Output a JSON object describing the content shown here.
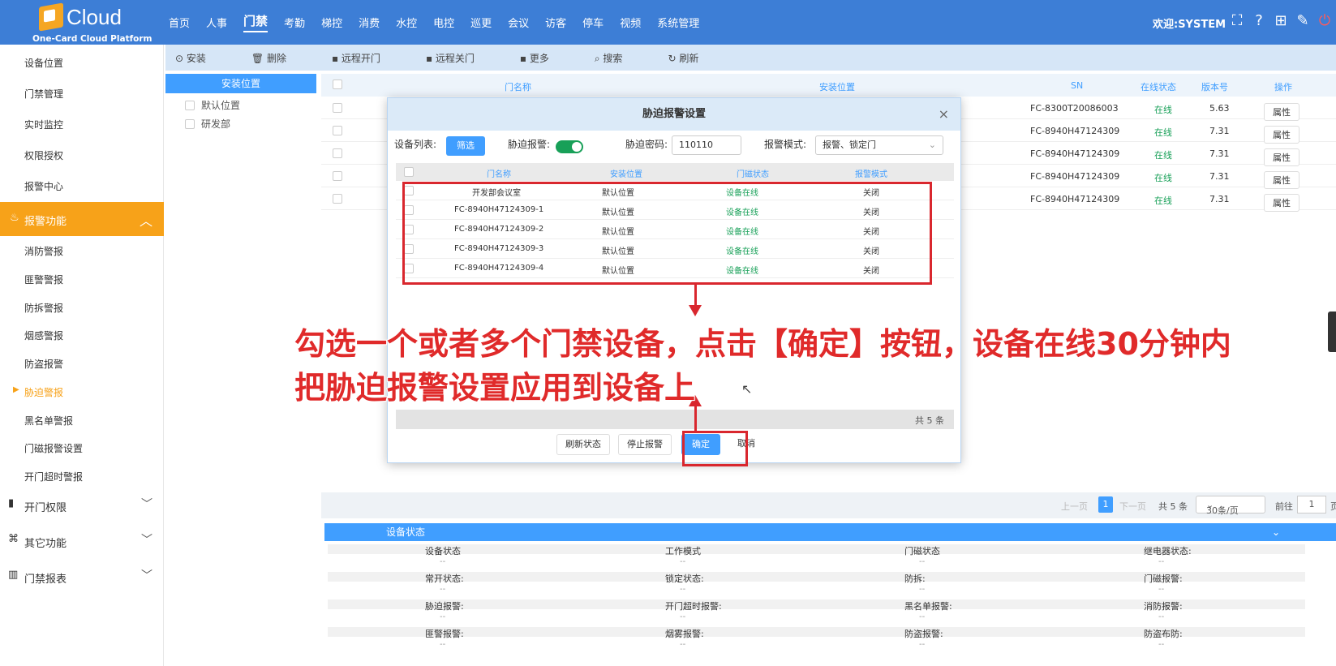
{
  "header": {
    "brand": "Cloud",
    "subtitle": "One-Card Cloud Platform",
    "nav": [
      "首页",
      "人事",
      "门禁",
      "考勤",
      "梯控",
      "消费",
      "水控",
      "电控",
      "巡更",
      "会议",
      "访客",
      "停车",
      "视频",
      "系统管理"
    ],
    "welcome": "欢迎:SYSTEM"
  },
  "sidebar": {
    "top_items": [
      "设备位置",
      "门禁管理",
      "实时监控",
      "权限授权",
      "报警中心"
    ],
    "group": "报警功能",
    "group_items": [
      "消防警报",
      "匪警警报",
      "防拆警报",
      "烟感警报",
      "防盗报警",
      "胁迫警报",
      "黑名单警报",
      "门磁报警设置",
      "开门超时警报"
    ],
    "collapsed": [
      "开门权限",
      "其它功能",
      "门禁报表"
    ]
  },
  "toolbar": [
    "安装",
    "删除",
    "远程开门",
    "远程关门",
    "更多",
    "搜索",
    "刷新"
  ],
  "tree": {
    "header": "安装位置",
    "nodes": [
      "默认位置",
      "研发部"
    ]
  },
  "main_table": {
    "headers": [
      "门名称",
      "安装位置",
      "SN",
      "在线状态",
      "版本号",
      "操作"
    ],
    "rows": [
      {
        "sn": "FC-8300T20086003",
        "status": "在线",
        "version": "5.63",
        "op": "属性"
      },
      {
        "sn": "FC-8940H47124309",
        "status": "在线",
        "version": "7.31",
        "op": "属性"
      },
      {
        "sn": "FC-8940H47124309",
        "status": "在线",
        "version": "7.31",
        "op": "属性"
      },
      {
        "sn": "FC-8940H47124309",
        "status": "在线",
        "version": "7.31",
        "op": "属性"
      },
      {
        "sn": "FC-8940H47124309",
        "status": "在线",
        "version": "7.31",
        "op": "属性"
      }
    ]
  },
  "pager": {
    "prev": "上一页",
    "page": "1",
    "next": "下一页",
    "total": "共 5 条",
    "size": "30条/页",
    "goto": "前往",
    "goto_value": "1",
    "page_suffix": "页"
  },
  "device_status": {
    "title": "设备状态",
    "rows": [
      [
        "设备状态",
        "工作模式",
        "门磁状态",
        "继电器状态:"
      ],
      [
        "常开状态:",
        "锁定状态:",
        "防拆:",
        "门磁报警:"
      ],
      [
        "胁迫报警:",
        "开门超时报警:",
        "黑名单报警:",
        "消防报警:"
      ],
      [
        "匪警报警:",
        "烟雾报警:",
        "防盗报警:",
        "防盗布防:"
      ]
    ],
    "placeholder": "--"
  },
  "modal": {
    "title": "胁迫报警设置",
    "device_list_label": "设备列表:",
    "filter_btn": "筛选",
    "duress_alarm_label": "胁迫报警:",
    "duress_pwd_label": "胁迫密码:",
    "duress_pwd_value": "110110",
    "alarm_mode_label": "报警模式:",
    "alarm_mode_value": "报警、锁定门",
    "headers": [
      "门名称",
      "安装位置",
      "门磁状态",
      "报警模式"
    ],
    "rows": [
      [
        "开发部会议室",
        "默认位置",
        "设备在线",
        "关闭"
      ],
      [
        "FC-8940H47124309-1",
        "默认位置",
        "设备在线",
        "关闭"
      ],
      [
        "FC-8940H47124309-2",
        "默认位置",
        "设备在线",
        "关闭"
      ],
      [
        "FC-8940H47124309-3",
        "默认位置",
        "设备在线",
        "关闭"
      ],
      [
        "FC-8940H47124309-4",
        "默认位置",
        "设备在线",
        "关闭"
      ]
    ],
    "total": "共 5 条",
    "buttons": {
      "refresh": "刷新状态",
      "stop": "停止报警",
      "ok": "确定",
      "cancel": "取消"
    }
  },
  "annotation": {
    "line1": "勾选一个或者多个门禁设备，点击【确定】按钮，设备在线30分钟内",
    "line2": "把胁迫报警设置应用到设备上"
  },
  "colors": {
    "primary": "#409eff",
    "accent": "#f7a219",
    "header": "#3d7ed6",
    "annotation": "#e02a2a"
  }
}
